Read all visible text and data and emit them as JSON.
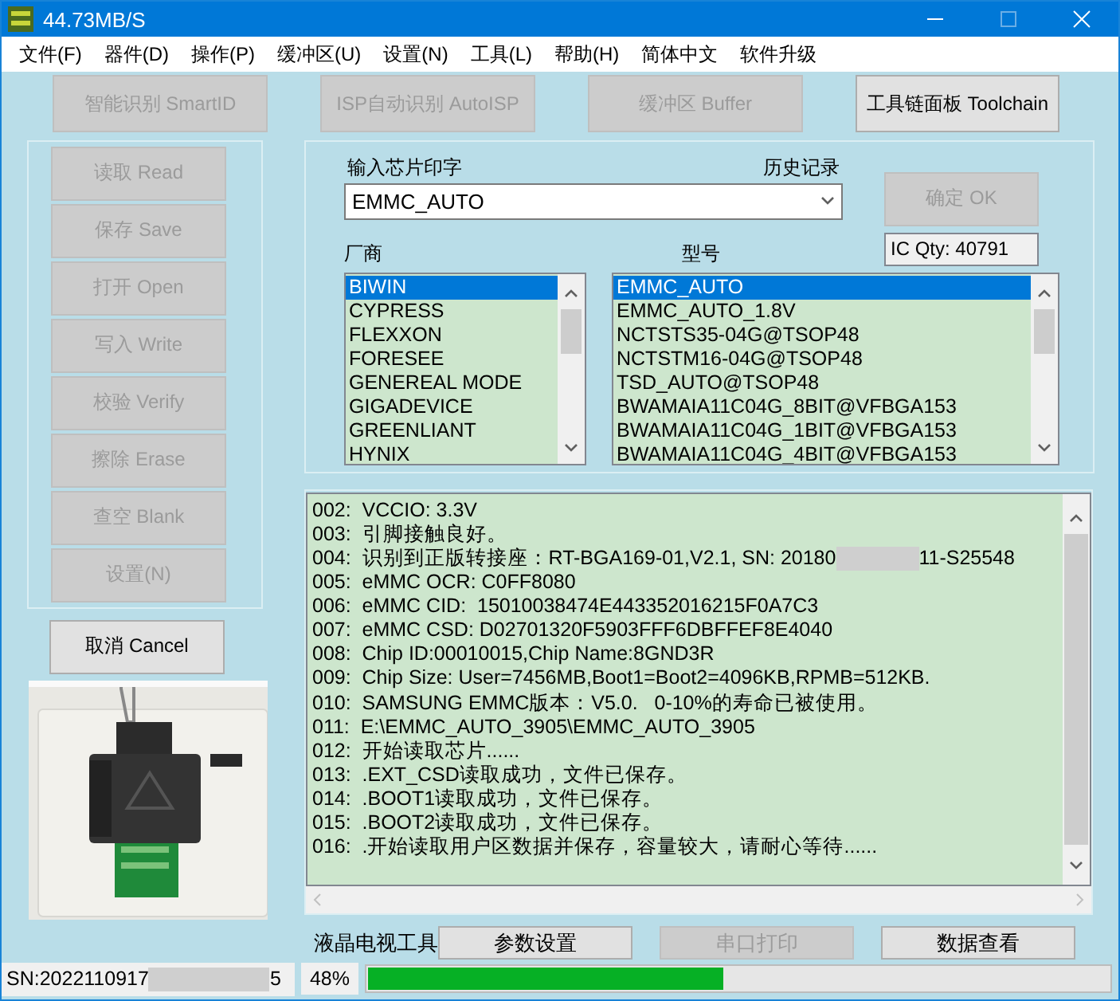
{
  "window": {
    "title": "44.73MB/S"
  },
  "menu": [
    "文件(F)",
    "器件(D)",
    "操作(P)",
    "缓冲区(U)",
    "设置(N)",
    "工具(L)",
    "帮助(H)",
    "简体中文",
    "软件升级"
  ],
  "toolbar": [
    {
      "label": "智能识别 SmartID",
      "disabled": true
    },
    {
      "label": "ISP自动识别 AutoISP",
      "disabled": true
    },
    {
      "label": "缓冲区 Buffer",
      "disabled": true
    },
    {
      "label": "工具链面板 Toolchain",
      "disabled": false
    }
  ],
  "actions": [
    {
      "label": "读取 Read",
      "disabled": true
    },
    {
      "label": "保存 Save",
      "disabled": true
    },
    {
      "label": "打开 Open",
      "disabled": true
    },
    {
      "label": "写入 Write",
      "disabled": true
    },
    {
      "label": "校验 Verify",
      "disabled": true
    },
    {
      "label": "擦除 Erase",
      "disabled": true
    },
    {
      "label": "查空 Blank",
      "disabled": true
    },
    {
      "label": "设置(N)",
      "disabled": true
    }
  ],
  "cancel": {
    "label": "取消 Cancel",
    "disabled": false
  },
  "chip": {
    "label": "输入芯片印字",
    "history_label": "历史记录",
    "value": "EMMC_AUTO",
    "ok": {
      "label": "确定 OK",
      "disabled": true
    },
    "ic_qty": "IC Qty: 40791"
  },
  "vendors": {
    "label": "厂商",
    "items": [
      {
        "name": "BIWIN",
        "selected": true
      },
      {
        "name": "CYPRESS",
        "selected": false
      },
      {
        "name": "FLEXXON",
        "selected": false
      },
      {
        "name": "FORESEE",
        "selected": false
      },
      {
        "name": "GENEREAL MODE",
        "selected": false
      },
      {
        "name": "GIGADEVICE",
        "selected": false
      },
      {
        "name": "GREENLIANT",
        "selected": false
      },
      {
        "name": "HYNIX",
        "selected": false
      }
    ]
  },
  "models": {
    "label": "型号",
    "items": [
      {
        "name": "EMMC_AUTO",
        "selected": true
      },
      {
        "name": "EMMC_AUTO_1.8V",
        "selected": false
      },
      {
        "name": "NCTSTS35-04G@TSOP48",
        "selected": false
      },
      {
        "name": "NCTSTM16-04G@TSOP48",
        "selected": false
      },
      {
        "name": "TSD_AUTO@TSOP48",
        "selected": false
      },
      {
        "name": "BWAMAIA11C04G_8BIT@VFBGA153",
        "selected": false
      },
      {
        "name": "BWAMAIA11C04G_1BIT@VFBGA153",
        "selected": false
      },
      {
        "name": "BWAMAIA11C04G_4BIT@VFBGA153",
        "selected": false
      }
    ]
  },
  "log": [
    {
      "text": "002:  VCCIO: 3.3V"
    },
    {
      "text": "003:  引脚接触良好。"
    },
    {
      "text": "004:  识别到正版转接座：RT-BGA169-01,V2.1, SN: 20180",
      "after_redaction": "11-S25548"
    },
    {
      "text": "005:  eMMC OCR: C0FF8080"
    },
    {
      "text": "006:  eMMC CID:  15010038474E443352016215F0A7C3"
    },
    {
      "text": "007:  eMMC CSD: D02701320F5903FFF6DBFFEF8E4040"
    },
    {
      "text": "008:  Chip ID:00010015,Chip Name:8GND3R"
    },
    {
      "text": "009:  Chip Size: User=7456MB,Boot1=Boot2=4096KB,RPMB=512KB."
    },
    {
      "text": "010:  SAMSUNG EMMC版本：V5.0.   0-10%的寿命已被使用。"
    },
    {
      "text": "011:  E:\\EMMC_AUTO_3905\\EMMC_AUTO_3905"
    },
    {
      "text": "012:  开始读取芯片......"
    },
    {
      "text": "013:  .EXT_CSD读取成功，文件已保存。"
    },
    {
      "text": "014:  .BOOT1读取成功，文件已保存。"
    },
    {
      "text": "015:  .BOOT2读取成功，文件已保存。"
    },
    {
      "text": "016:  .开始读取用户区数据并保存，容量较大，请耐心等待......"
    }
  ],
  "tools": {
    "label": "液晶电视工具",
    "buttons": [
      {
        "label": "参数设置",
        "disabled": false
      },
      {
        "label": "串口打印",
        "disabled": true
      },
      {
        "label": "数据查看",
        "disabled": false
      }
    ]
  },
  "status_bar": {
    "sn": "SN:2022110917",
    "sn_after_redaction": "5",
    "progress": {
      "reading": "48%",
      "level": 0.48
    }
  }
}
